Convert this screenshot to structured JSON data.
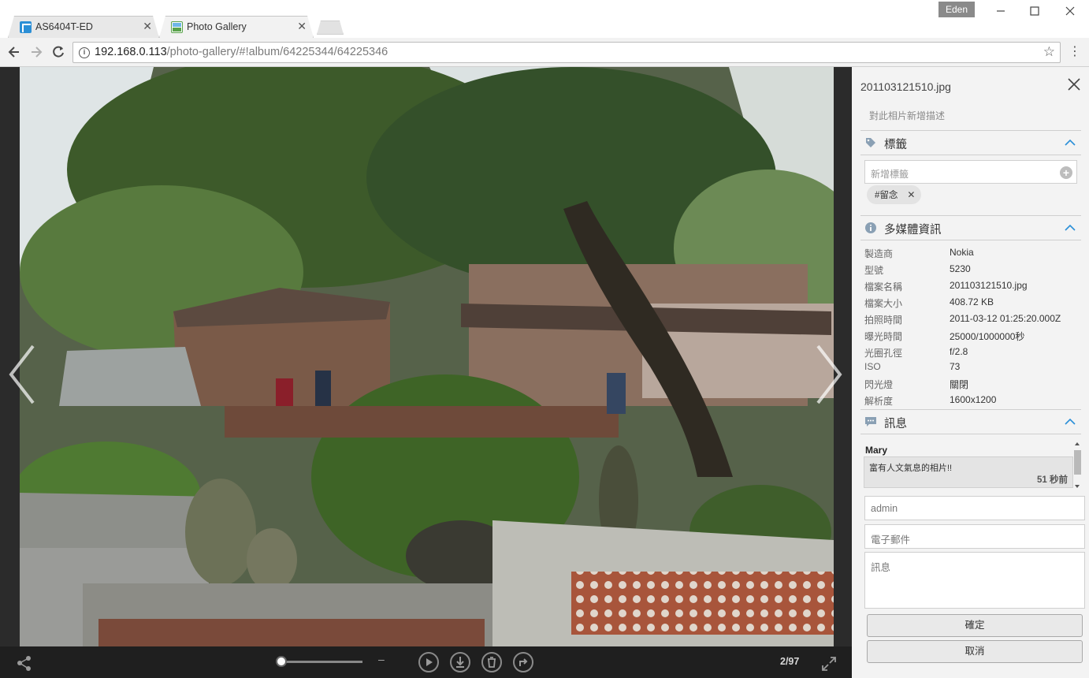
{
  "browser": {
    "tabs": [
      {
        "title": "AS6404T-ED"
      },
      {
        "title": "Photo Gallery"
      }
    ],
    "profile_name": "Eden",
    "url_host": "192.168.0.113",
    "url_path": "/photo-gallery/#!album/64225344/64225346",
    "window_controls": {
      "minimize": "—",
      "maximize": "☐",
      "close": "✕"
    }
  },
  "viewer": {
    "counter": "2/97",
    "slider_position": 0.02,
    "icons": [
      "share-icon",
      "play-icon",
      "download-icon",
      "delete-icon",
      "rotate-icon",
      "fullscreen-icon"
    ]
  },
  "panel": {
    "filename": "201103121510.jpg",
    "description_placeholder": "對此相片新增描述",
    "tags": {
      "title": "標籤",
      "input_placeholder": "新增標籤",
      "items": [
        "#留念"
      ]
    },
    "media_info": {
      "title": "多媒體資訊",
      "rows": [
        {
          "key": "製造商",
          "value": "Nokia"
        },
        {
          "key": "型號",
          "value": "5230"
        },
        {
          "key": "檔案名稱",
          "value": "201103121510.jpg"
        },
        {
          "key": "檔案大小",
          "value": "408.72 KB"
        },
        {
          "key": "拍照時間",
          "value": "2011-03-12 01:25:20.000Z"
        },
        {
          "key": "曝光時間",
          "value": "25000/1000000秒"
        },
        {
          "key": "光圈孔徑",
          "value": "f/2.8"
        },
        {
          "key": "ISO",
          "value": "73"
        },
        {
          "key": "閃光燈",
          "value": "關閉"
        },
        {
          "key": "解析度",
          "value": "1600x1200"
        }
      ]
    },
    "messages": {
      "title": "訊息",
      "items": [
        {
          "author": "Mary",
          "text": "富有人文氣息的相片!!",
          "time": "51 秒前"
        }
      ],
      "name_value": "admin",
      "email_placeholder": "電子郵件",
      "message_placeholder": "訊息",
      "confirm_label": "確定",
      "cancel_label": "取消"
    }
  },
  "colors": {
    "accent": "#2a8fd8",
    "panel_bg": "#f3f3f3",
    "viewer_bg": "#2b2b2b"
  }
}
